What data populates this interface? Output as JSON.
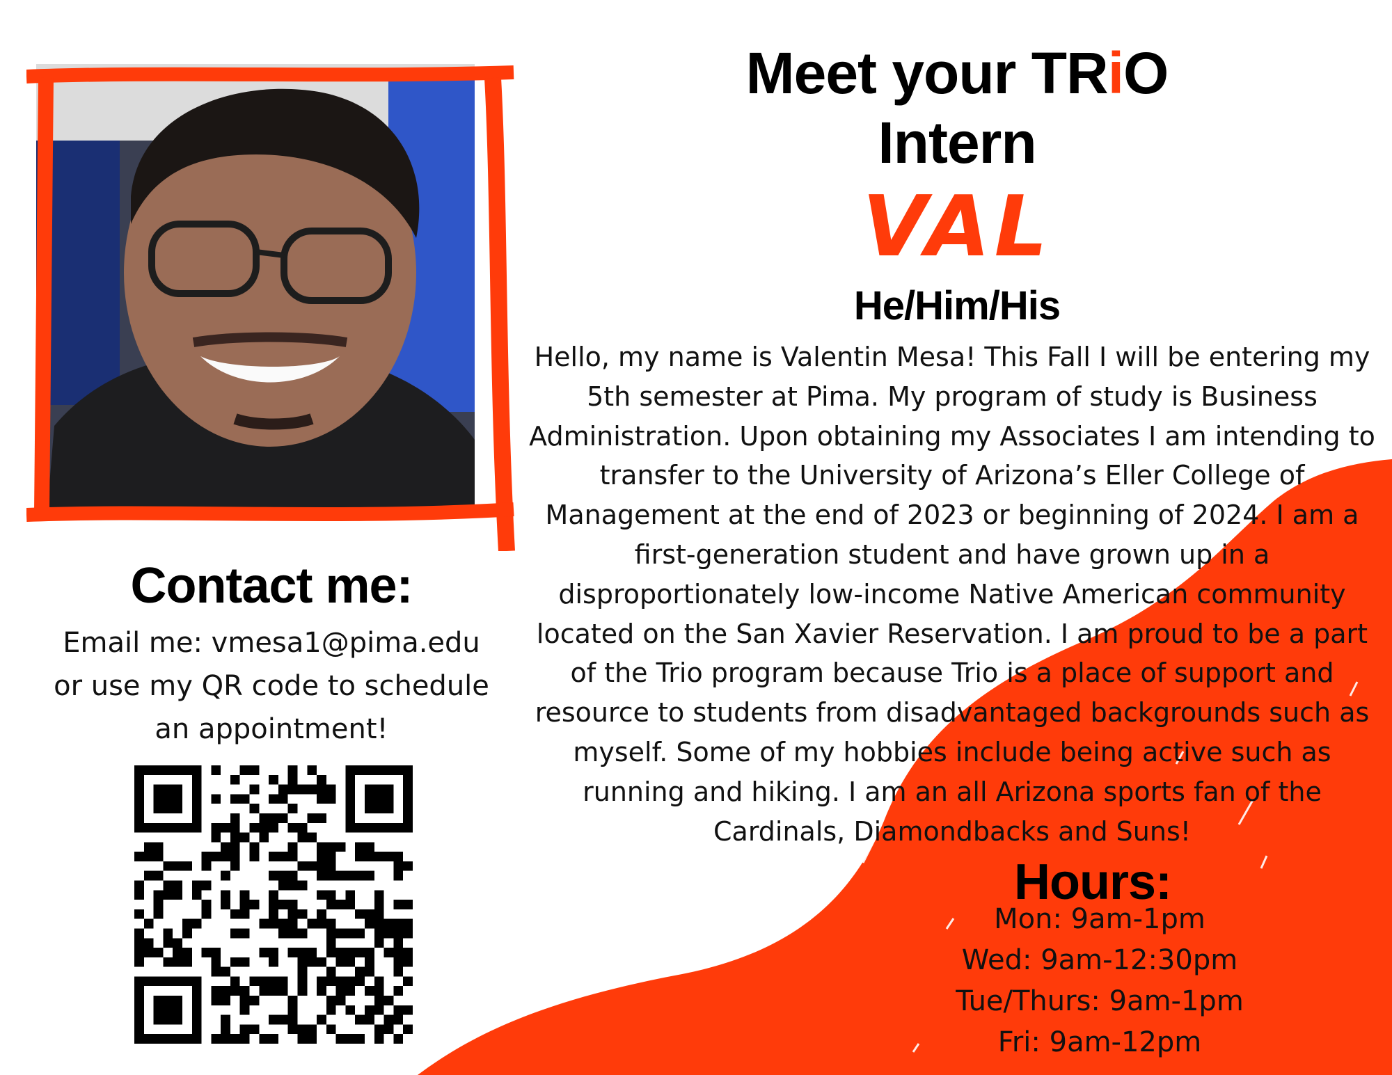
{
  "header": {
    "title_line1_prefix": "Meet your TR",
    "title_line1_i": "i",
    "title_line1_suffix": "O",
    "title_line2": "Intern"
  },
  "intern": {
    "name": "VAL",
    "pronouns": "He/Him/His",
    "bio": "Hello, my name is Valentin Mesa! This Fall I will be entering my 5th semester at Pima. My program of study is Business Administration. Upon obtaining my Associates I am intending to transfer to the University of Arizona’s Eller College of Management at the end of 2023 or beginning of 2024. I am a first-generation student and have grown up in a disproportionately low-income Native American community located on the San Xavier Reservation. I am proud to be a part of the Trio program because Trio is a place of support and resource to students from disadvantaged backgrounds such as myself. Some of my hobbies include being active such as running and hiking. I am an all Arizona sports fan of the Cardinals, Diamondbacks and Suns!"
  },
  "contact": {
    "title": "Contact me:",
    "email_line": "Email me:  vmesa1@pima.edu",
    "qr_line": "or use my QR code to schedule",
    "qr_line2": "an appointment!"
  },
  "hours": {
    "title": "Hours:",
    "items": [
      "Mon: 9am-1pm",
      "Wed: 9am-12:30pm",
      "Tue/Thurs: 9am-1pm",
      "Fri: 9am-12pm"
    ]
  },
  "colors": {
    "accent": "#ff3b0a",
    "text": "#111111",
    "background": "#ffffff"
  },
  "icons": {
    "photo": "intern-photo",
    "qr": "qr-code"
  }
}
